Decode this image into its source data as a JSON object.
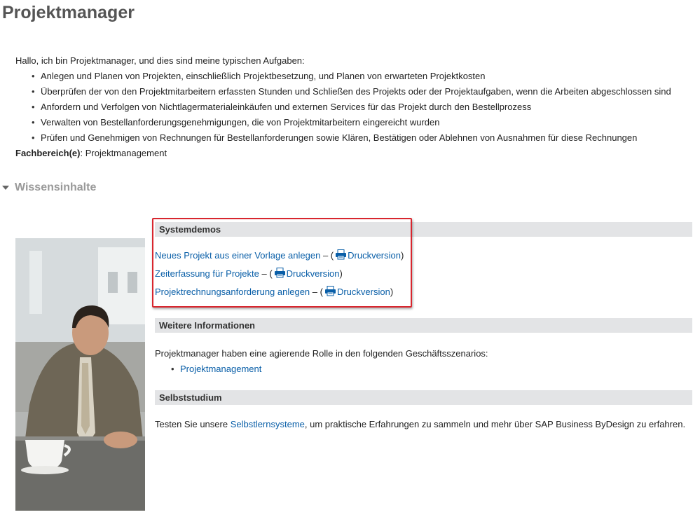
{
  "page": {
    "title": "Projektmanager"
  },
  "intro": {
    "greeting": "Hallo, ich bin Projektmanager, und dies sind meine typischen Aufgaben:",
    "tasks": [
      "Anlegen und Planen von Projekten, einschließlich Projektbesetzung, und Planen von erwarteten Projektkosten",
      "Überprüfen der von den Projektmitarbeitern erfassten Stunden und Schließen des Projekts oder der Projektaufgaben, wenn die Arbeiten abgeschlossen sind",
      "Anfordern und Verfolgen von Nichtlagermaterialeinkäufen und externen Services für das Projekt durch den Bestellprozess",
      "Verwalten von Bestellanforderungsgenehmigungen, die von Projektmitarbeitern eingereicht wurden",
      "Prüfen und Genehmigen von Rechnungen für Bestellanforderungen sowie Klären, Bestätigen oder Ablehnen von Ausnahmen für diese Rechnungen"
    ],
    "area_label": "Fachbereich(e)",
    "area_sep": ":",
    "area_value": " Projektmanagement"
  },
  "knowledge": {
    "title": "Wissensinhalte"
  },
  "system_demos": {
    "header": "Systemdemos",
    "separator": " – (",
    "close": ")",
    "print_label": "Druckversion",
    "items": [
      {
        "label": "Neues Projekt aus einer Vorlage anlegen"
      },
      {
        "label": "Zeiterfassung für Projekte"
      },
      {
        "label": "Projektrechnungsanforderung anlegen"
      }
    ]
  },
  "more_info": {
    "header": "Weitere Informationen",
    "text": "Projektmanager haben eine agierende Rolle in den folgenden Geschäftsszenarios:",
    "links": [
      "Projektmanagement"
    ]
  },
  "self_study": {
    "header": "Selbststudium",
    "text_before": "Testen Sie unsere ",
    "link": "Selbstlernsysteme",
    "text_after": ", um praktische Erfahrungen zu sammeln und mehr über SAP Business ByDesign zu erfahren."
  },
  "icons": {
    "print": "printer-icon",
    "toggle": "triangle-down-icon"
  },
  "colors": {
    "link": "#0a5fa8",
    "header_bg": "#e3e4e6",
    "highlight": "#d8262e",
    "title": "#555555"
  }
}
